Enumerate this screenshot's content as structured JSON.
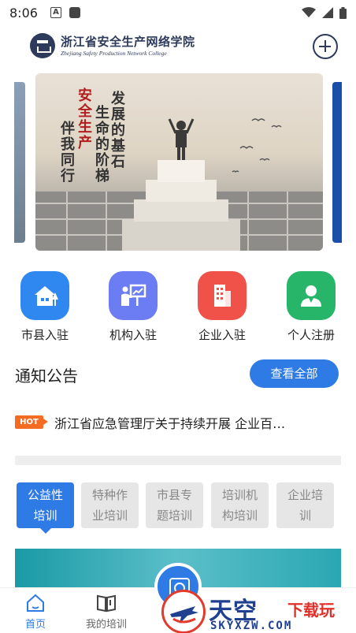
{
  "status_bar": {
    "time": "8:06",
    "notification_icons": [
      "a-icon",
      "square-icon"
    ],
    "system_icons": [
      "wifi-icon",
      "signal-icon",
      "battery-icon"
    ]
  },
  "header": {
    "logo_cn": "浙江省安全生产网络学院",
    "logo_en": "Zhejiang Safety Production Network College",
    "add_icon": "plus-circle-icon"
  },
  "banner": {
    "lines": [
      "发展的基石",
      "生命的阶梯",
      "安全生产",
      "伴我同行"
    ]
  },
  "quick_entries": [
    {
      "label": "市县入驻",
      "icon": "house-icon",
      "color": "#2f88f0"
    },
    {
      "label": "机构入驻",
      "icon": "presenter-icon",
      "color": "#6c7cf2"
    },
    {
      "label": "企业入驻",
      "icon": "building-icon",
      "color": "#f0524a"
    },
    {
      "label": "个人注册",
      "icon": "person-icon",
      "color": "#27b56a"
    }
  ],
  "notice": {
    "title": "通知公告",
    "view_all": "查看全部",
    "hot_badge": "HOT",
    "item": "浙江省应急管理厅关于持续开展 企业百…"
  },
  "categories": [
    {
      "label": "公益性\n培训",
      "active": true
    },
    {
      "label": "特种作\n业培训",
      "active": false
    },
    {
      "label": "市县专\n题培训",
      "active": false
    },
    {
      "label": "培训机\n构培训",
      "active": false
    },
    {
      "label": "企业培\n训",
      "active": false
    }
  ],
  "bottom_nav": {
    "items": [
      {
        "label": "首页",
        "icon": "home-icon",
        "active": true
      },
      {
        "label": "我的培训",
        "icon": "book-icon",
        "active": false
      }
    ],
    "center_icon": "scan-face-icon",
    "active_color": "#2f7be6"
  },
  "watermark": {
    "cn_main": "天空",
    "cn_sub": "下载玩",
    "en": "SKYXZW.COM"
  }
}
